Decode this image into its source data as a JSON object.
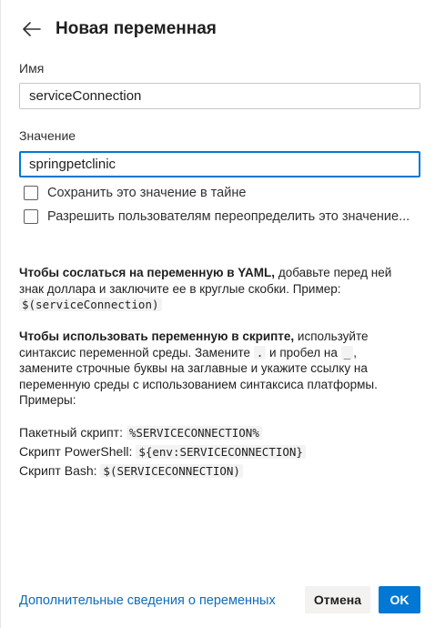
{
  "header": {
    "title": "Новая переменная",
    "back_icon": "arrow-left-icon"
  },
  "form": {
    "name_label": "Имя",
    "name_value": "serviceConnection",
    "value_label": "Значение",
    "value_value": "springpetclinic",
    "checkbox_secret": {
      "label": "Сохранить это значение в тайне",
      "checked": false
    },
    "checkbox_override": {
      "label": "Разрешить пользователям переопределить это значение...",
      "checked": false
    }
  },
  "info": {
    "yaml_bold": "Чтобы сослаться на переменную в YAML,",
    "yaml_text": " добавьте перед ней знак доллара и заключите ее в круглые скобки. Пример: ",
    "yaml_example": "$(serviceConnection)",
    "script_bold": "Чтобы использовать переменную в скрипте,",
    "script_text1": " используйте синтаксис переменной среды. Замените ",
    "script_dot": ".",
    "script_text2": " и пробел на ",
    "script_underscore": "_",
    "script_text3": ", замените строчные буквы на заглавные и укажите ссылку на переменную среды с использованием синтаксиса платформы. Примеры:"
  },
  "examples": [
    {
      "label": "Пакетный скрипт:",
      "code": "%SERVICECONNECTION%"
    },
    {
      "label": "Скрипт PowerShell:",
      "code": "${env:SERVICECONNECTION}"
    },
    {
      "label": "Скрипт Bash:",
      "code": "$(SERVICECONNECTION)"
    }
  ],
  "footer": {
    "link": "Дополнительные сведения о переменных",
    "cancel": "Отмена",
    "ok": "OK"
  },
  "colors": {
    "accent": "#0078d4",
    "link": "#0f6cbd"
  }
}
